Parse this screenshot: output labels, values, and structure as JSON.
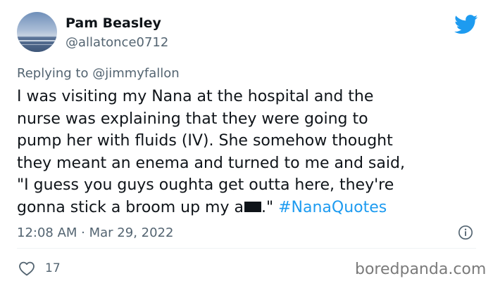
{
  "tweet": {
    "author_name": "Pam Beasley",
    "author_handle": "@allatonce0712",
    "replying_prefix": "Replying to ",
    "replying_to": "@jimmyfallon",
    "lines": [
      "I was visiting my Nana at the hospital and the",
      "nurse was explaining that they were going to",
      "pump her with fluids (IV). She somehow thought",
      "they meant an enema and turned to me and said,",
      "\"I guess you guys oughta get outta here, they're"
    ],
    "last_line_prefix": "gonna stick a broom up my a",
    "last_line_suffix": ".\" ",
    "hashtag": "#NanaQuotes",
    "timestamp": "12:08 AM · Mar 29, 2022",
    "like_count": "17"
  },
  "icons": {
    "platform": "twitter-bird-icon",
    "info": "info-icon",
    "like": "heart-icon"
  },
  "colors": {
    "brand": "#1d9bf0",
    "text": "#0f1419",
    "muted": "#536471"
  },
  "watermark": "boredpanda.com"
}
